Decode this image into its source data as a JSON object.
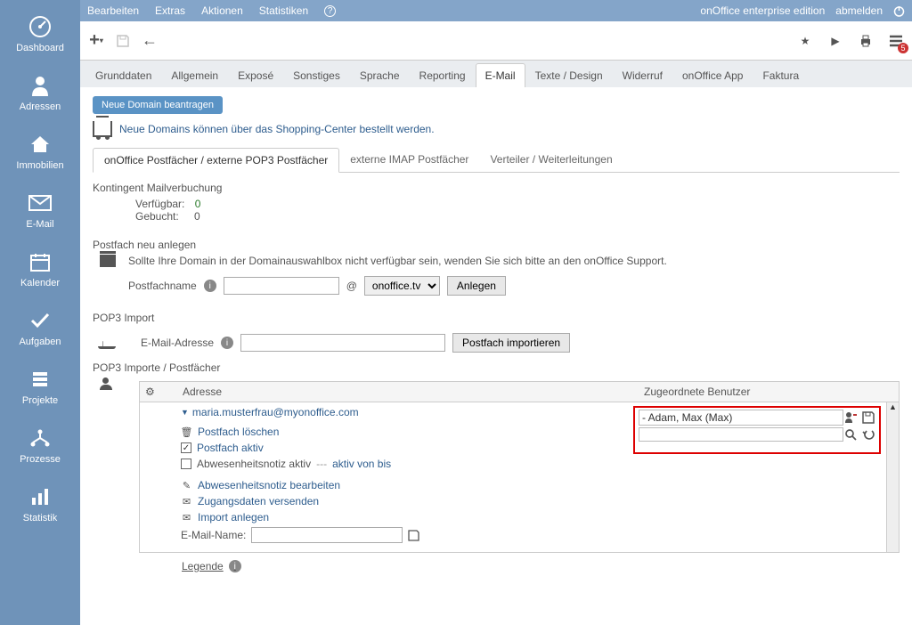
{
  "sidebar": {
    "items": [
      {
        "label": "Dashboard"
      },
      {
        "label": "Adressen"
      },
      {
        "label": "Immobilien"
      },
      {
        "label": "E-Mail"
      },
      {
        "label": "Kalender"
      },
      {
        "label": "Aufgaben"
      },
      {
        "label": "Projekte"
      },
      {
        "label": "Prozesse"
      },
      {
        "label": "Statistik"
      }
    ]
  },
  "topbar": {
    "menu": [
      "Bearbeiten",
      "Extras",
      "Aktionen",
      "Statistiken"
    ],
    "edition": "onOffice enterprise edition",
    "logout": "abmelden"
  },
  "toolbar": {
    "badge_count": "5"
  },
  "tabs": [
    "Grunddaten",
    "Allgemein",
    "Exposé",
    "Sonstiges",
    "Sprache",
    "Reporting",
    "E-Mail",
    "Texte / Design",
    "Widerruf",
    "onOffice App",
    "Faktura"
  ],
  "active_tab": "E-Mail",
  "domain": {
    "request_btn": "Neue Domain beantragen",
    "info": "Neue Domains können über das Shopping-Center bestellt werden."
  },
  "subtabs": [
    "onOffice Postfächer / externe POP3 Postfächer",
    "externe IMAP Postfächer",
    "Verteiler / Weiterleitungen"
  ],
  "kontingent": {
    "title": "Kontingent Mailverbuchung",
    "available_label": "Verfügbar:",
    "available_val": "0",
    "booked_label": "Gebucht:",
    "booked_val": "0"
  },
  "postfach_neu": {
    "title": "Postfach neu anlegen",
    "note": "Sollte Ihre Domain in der Domainauswahlbox nicht verfügbar sein, wenden Sie sich bitte an den onOffice Support.",
    "name_label": "Postfachname",
    "at": "@",
    "domain_select": "onoffice.tv",
    "create_btn": "Anlegen"
  },
  "pop3_import": {
    "title": "POP3 Import",
    "email_label": "E-Mail-Adresse",
    "import_btn": "Postfach importieren"
  },
  "pop3_list": {
    "title": "POP3 Importe / Postfächer",
    "col_adresse": "Adresse",
    "col_benutzer": "Zugeordnete Benutzer",
    "email": "maria.musterfrau@myonoffice.com",
    "actions": {
      "delete": "Postfach löschen",
      "active": "Postfach aktiv",
      "away_note": "Abwesenheitsnotiz aktiv",
      "away_dash": "---",
      "away_from": "aktiv von bis",
      "edit_away": "Abwesenheitsnotiz bearbeiten",
      "send_creds": "Zugangsdaten versenden",
      "create_import": "Import anlegen",
      "email_name_label": "E-Mail-Name:"
    },
    "assigned_user": "- Adam, Max (Max)"
  },
  "legende": "Legende"
}
